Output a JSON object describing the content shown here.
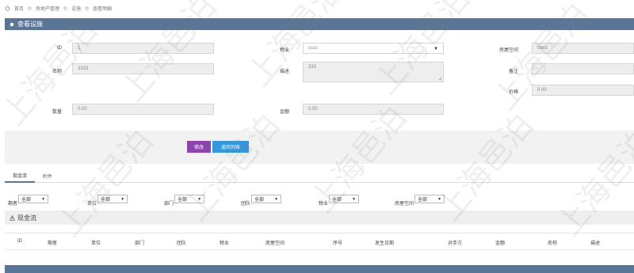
{
  "breadcrumb": [
    "首页",
    "房地产管理",
    "设施",
    "查看明细"
  ],
  "panel": {
    "title": "查看设施"
  },
  "form": {
    "id": {
      "label": "ID",
      "value": "1"
    },
    "property": {
      "label": "物业",
      "value": "ssss"
    },
    "space": {
      "label": "房屋空间",
      "value": "tttest"
    },
    "name": {
      "label": "名称",
      "value": "3333"
    },
    "description": {
      "label": "描述",
      "value": "333"
    },
    "note": {
      "label": "备注",
      "value": ""
    },
    "price": {
      "label": "价格",
      "value": "0.00"
    },
    "quantity": {
      "label": "数量",
      "value": "0.00"
    },
    "amount": {
      "label": "金额",
      "value": "0.00"
    }
  },
  "buttons": {
    "edit": "修改",
    "back": "返回列表"
  },
  "tabs": [
    "现金流",
    "附件"
  ],
  "filters": [
    {
      "label": "期者",
      "value": "全部"
    },
    {
      "label": "单位",
      "value": "全部"
    },
    {
      "label": "部门",
      "value": "全部"
    },
    {
      "label": "团队",
      "value": "全部"
    },
    {
      "label": "物业",
      "value": "全部"
    },
    {
      "label": "房屋空间",
      "value": "全部"
    }
  ],
  "section": {
    "title": "现金流"
  },
  "table_headers": [
    "ID",
    "期者",
    "单位",
    "部门",
    "团队",
    "物业",
    "房屋空间",
    "序号",
    "发生日期",
    "对手方",
    "金额",
    "名称",
    "描述"
  ],
  "watermark": "上海邑泊",
  "colors": {
    "header": "#5a7696",
    "edit": "#8e44ad",
    "back": "#3498db"
  }
}
